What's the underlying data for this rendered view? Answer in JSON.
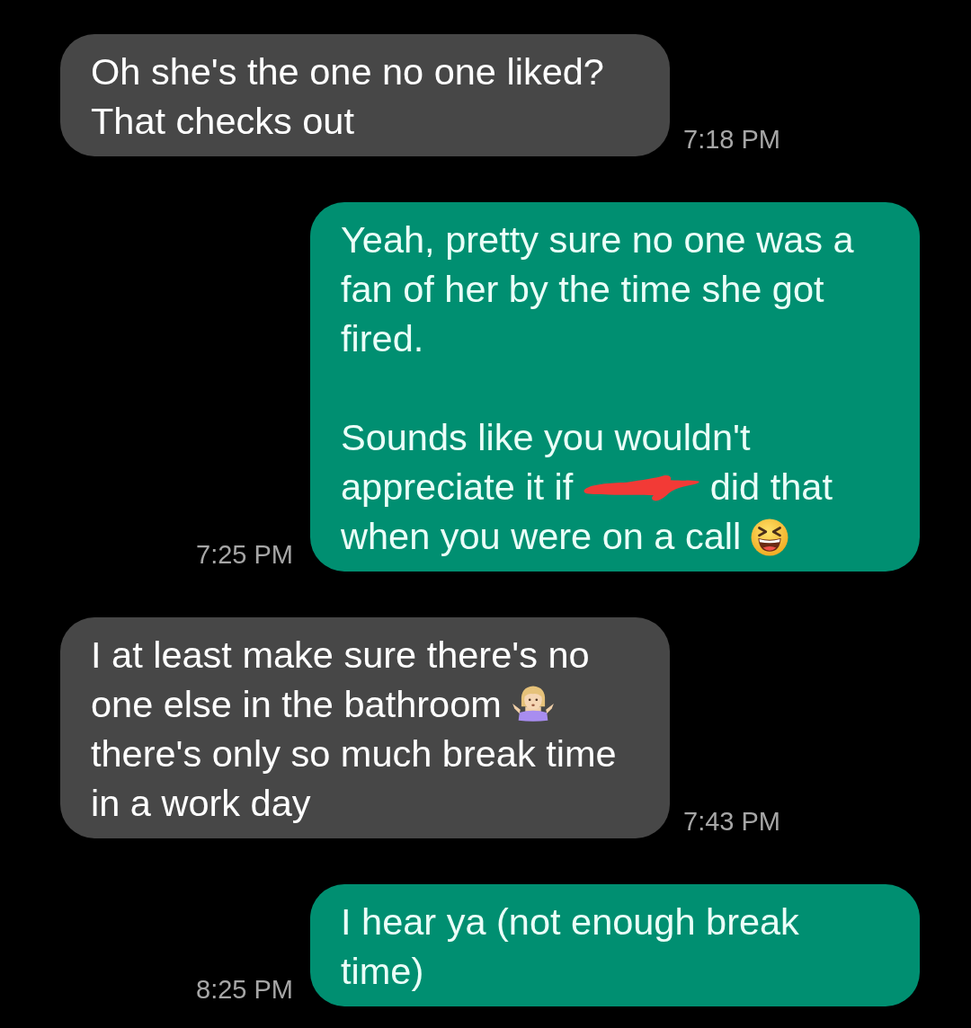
{
  "messages": [
    {
      "kind": "incoming",
      "time": "7:18 PM",
      "paragraphs": [
        [
          {
            "kind": "text",
            "text": "Oh she's the one no one liked? That checks out"
          }
        ]
      ]
    },
    {
      "kind": "outgoing",
      "time": "7:25 PM",
      "paragraphs": [
        [
          {
            "kind": "text",
            "text": "Yeah, pretty sure no one was a fan of her by the time she got fired."
          }
        ],
        [
          {
            "kind": "text",
            "text": "Sounds like you wouldn't"
          },
          {
            "kind": "text",
            "text": "appreciate it if"
          },
          {
            "kind": "redaction"
          },
          {
            "kind": "text",
            "text": "did that"
          },
          {
            "kind": "text",
            "text": "when you were on a call"
          },
          {
            "kind": "laugh"
          }
        ]
      ]
    },
    {
      "kind": "incoming",
      "time": "7:43 PM",
      "paragraphs": [
        [
          {
            "kind": "text",
            "text": "I at least make sure there's no"
          },
          {
            "kind": "text",
            "text": "one else in the bathroom"
          },
          {
            "kind": "shrug"
          },
          {
            "kind": "text",
            "text": "there's only so much break time"
          },
          {
            "kind": "text",
            "text": "in a work day"
          }
        ]
      ]
    },
    {
      "kind": "outgoing",
      "time": "8:25 PM",
      "paragraphs": [
        [
          {
            "kind": "text",
            "text": "I hear ya (not enough break time)"
          }
        ]
      ]
    }
  ]
}
